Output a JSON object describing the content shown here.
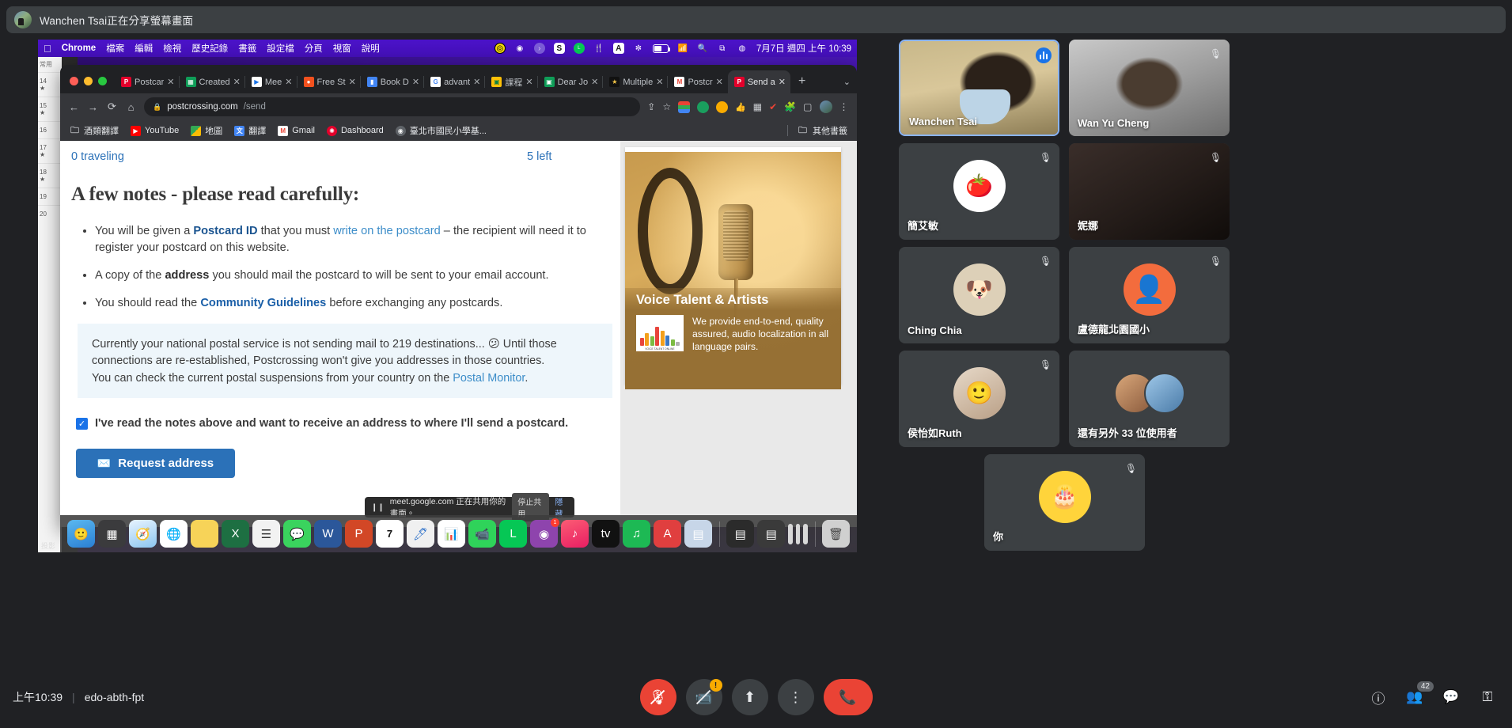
{
  "share_banner": {
    "text": "Wanchen Tsai正在分享螢幕畫面",
    "avatar_name": "presenter-avatar"
  },
  "mac_menubar": {
    "apple": "",
    "items": [
      "Chrome",
      "檔案",
      "編輯",
      "檢視",
      "歷史記錄",
      "書籤",
      "設定檔",
      "分頁",
      "視窗",
      "說明"
    ],
    "status_icons": [
      "yellow-circle-icon",
      "camera-rec-icon",
      "purple-arrow-icon",
      "s-badge-icon",
      "line-icon",
      "utensils-icon",
      "input-source-a-icon",
      "bluetooth-icon",
      "battery-icon",
      "wifi-icon",
      "search-icon",
      "control-center-icon",
      "siri-icon"
    ],
    "clock": "7月7日 週四 上午 10:39"
  },
  "chrome": {
    "tabs": [
      {
        "title": "Postcar",
        "favicon": "postcrossing-icon",
        "active": false
      },
      {
        "title": "Created",
        "favicon": "sheets-icon",
        "active": false
      },
      {
        "title": "Mee",
        "favicon": "meet-icon",
        "active": false
      },
      {
        "title": "Free St",
        "favicon": "orange-icon",
        "active": false
      },
      {
        "title": "Book D",
        "favicon": "blue-book-icon",
        "active": false
      },
      {
        "title": "advant",
        "favicon": "google-icon",
        "active": false
      },
      {
        "title": "課程",
        "favicon": "classroom-icon",
        "active": false
      },
      {
        "title": "Dear Jo",
        "favicon": "contacts-icon",
        "active": false
      },
      {
        "title": "Multiple",
        "favicon": "star-icon",
        "active": false
      },
      {
        "title": "Postcr",
        "favicon": "gmail-icon",
        "active": false
      },
      {
        "title": "Send a",
        "favicon": "postcrossing-icon",
        "active": true
      }
    ],
    "new_tab_label": "+",
    "tab_list_label": "⌄",
    "nav": {
      "back": "←",
      "forward": "→",
      "reload": "⟳",
      "home": "⌂"
    },
    "url": {
      "lock": "🔒",
      "host": "postcrossing.com",
      "path": "/send"
    },
    "omni_icons": [
      "share-icon",
      "bookmark-star-icon"
    ],
    "extensions": [
      "rainbow-extension-icon",
      "green-circle-extension-icon",
      "multicolor-extension-icon",
      "thumbs-up-icon",
      "grid-icon",
      "red-check-icon",
      "puzzle-icon",
      "side-panel-icon",
      "profile-avatar-icon",
      "three-dot-menu-icon"
    ],
    "bookmarks": [
      {
        "label": "酒類翻譯",
        "icon": "folder-icon"
      },
      {
        "label": "YouTube",
        "icon": "youtube-icon"
      },
      {
        "label": "地圖",
        "icon": "maps-icon"
      },
      {
        "label": "翻譯",
        "icon": "translate-icon"
      },
      {
        "label": "Gmail",
        "icon": "gmail-icon"
      },
      {
        "label": "Dashboard",
        "icon": "dashboard-icon"
      },
      {
        "label": "臺北市國民小學基...",
        "icon": "globe-icon"
      }
    ],
    "other_bookmarks": "其他書籤"
  },
  "page": {
    "counter_left": "0 traveling",
    "counter_right": "5 left",
    "title": "A few notes - please read carefully:",
    "notes": [
      {
        "parts": [
          {
            "t": "You will be given a ",
            "s": "plain"
          },
          {
            "t": "Postcard ID",
            "s": "link-bold"
          },
          {
            "t": " that you must ",
            "s": "plain"
          },
          {
            "t": "write on the postcard",
            "s": "link"
          },
          {
            "t": " – the recipient will need it to register your postcard on this website.",
            "s": "plain"
          }
        ]
      },
      {
        "parts": [
          {
            "t": "A copy of the ",
            "s": "plain"
          },
          {
            "t": "address",
            "s": "dark-bold"
          },
          {
            "t": " you should mail the postcard to will be sent to your email account.",
            "s": "plain"
          }
        ]
      },
      {
        "parts": [
          {
            "t": "You should read the ",
            "s": "plain"
          },
          {
            "t": "Community Guidelines",
            "s": "link-bold"
          },
          {
            "t": " before exchanging any postcards.",
            "s": "plain"
          }
        ]
      }
    ],
    "notice": {
      "line1": "Currently your national postal service is not sending mail to 219 destinations... 😕 Until those",
      "line2": "connections are re-established, Postcrossing won't give you addresses in those countries.",
      "line3_pre": "You can check the current postal suspensions from your country on the ",
      "line3_link": "Postal Monitor",
      "line3_post": "."
    },
    "checkbox_label": "I've read the notes above and want to receive an address to where I'll send a postcard.",
    "checkbox_checked": true,
    "request_button": "Request address"
  },
  "ad": {
    "title": "Voice Talent & Artists",
    "description": "We provide end-to-end, quality assured, audio localization in all language pairs.",
    "logo_caption": "VOICE TALENT ONLINE"
  },
  "chrome_share_bar": {
    "message": "meet.google.com 正在共用你的畫面。",
    "stop_label": "停止共用",
    "hide_label": "隱藏"
  },
  "dock": {
    "apps": [
      "finder-icon",
      "launchpad-icon",
      "safari-icon",
      "chrome-icon",
      "notes-icon",
      "excel-icon",
      "reminders-icon",
      "messages-icon",
      "word-icon",
      "powerpoint-icon",
      "calendar-7-icon",
      "preview-icon",
      "numbers-icon",
      "facetime-icon",
      "line-icon",
      "podcast-icon",
      "music-icon",
      "appletv-icon",
      "spotify-icon",
      "acrobat-icon",
      "stickies-icon"
    ],
    "minimized": [
      "window-thumb-1",
      "window-thumb-2",
      "window-thumb-3",
      "window-thumb-4",
      "window-thumb-5"
    ],
    "trash": "trash-icon",
    "calendar_day": "7",
    "desktop_label": "投影"
  },
  "participants": [
    {
      "name": "Wanchen Tsai",
      "avatar_type": "video",
      "muted": false,
      "speaking": true
    },
    {
      "name": "Wan Yu Cheng",
      "avatar_type": "video",
      "muted": true,
      "speaking": false
    },
    {
      "name": "簡艾敏",
      "avatar_type": "tomato-avatar",
      "muted": true,
      "speaking": false
    },
    {
      "name": "妮娜",
      "avatar_type": "dark-video",
      "muted": true,
      "speaking": false
    },
    {
      "name": "Ching Chia",
      "avatar_type": "dog-avatar",
      "muted": true,
      "speaking": false
    },
    {
      "name": "盧德龍北園國小",
      "avatar_type": "person-avatar",
      "muted": true,
      "speaking": false
    },
    {
      "name": "侯怡如Ruth",
      "avatar_type": "photo-avatar",
      "muted": true,
      "speaking": false
    },
    {
      "name": "還有另外 33 位使用者",
      "avatar_type": "group-avatar",
      "muted": false,
      "speaking": false
    },
    {
      "name": "你",
      "avatar_type": "cake-avatar",
      "muted": true,
      "speaking": false
    }
  ],
  "bottom_bar": {
    "time": "上午10:39",
    "separator": "|",
    "meeting_code": "edo-abth-fpt",
    "controls": [
      {
        "name": "microphone-off-button",
        "icon": "mic-off-icon",
        "style": "red"
      },
      {
        "name": "camera-button",
        "icon": "camera-off-icon",
        "style": "grey",
        "badge": "!"
      },
      {
        "name": "present-button",
        "icon": "present-screen-icon",
        "style": "grey"
      },
      {
        "name": "more-options-button",
        "icon": "three-dots-icon",
        "style": "grey"
      },
      {
        "name": "leave-call-button",
        "icon": "hangup-icon",
        "style": "hang"
      }
    ],
    "right_icons": [
      {
        "name": "meeting-details-button",
        "icon": "info-icon",
        "badge": ""
      },
      {
        "name": "participants-button",
        "icon": "people-icon",
        "badge": "42"
      },
      {
        "name": "chat-button",
        "icon": "chat-icon",
        "badge": ""
      },
      {
        "name": "activities-button",
        "icon": "activities-icon",
        "badge": ""
      }
    ]
  },
  "colors": {
    "meet_bg": "#202124",
    "tile_bg": "#3c4043",
    "accent_blue": "#8ab4f8",
    "red": "#ea4335",
    "link_blue": "#2b71b8"
  }
}
